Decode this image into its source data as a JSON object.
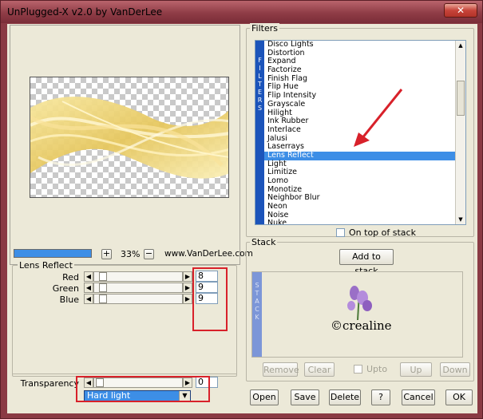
{
  "window": {
    "title": "UnPlugged-X v2.0 by VanDerLee",
    "close_glyph": "✕"
  },
  "preview": {
    "zoom_out_label": "+",
    "zoom_value": "33%",
    "zoom_in_label": "−",
    "website": "www.VanDerLee.com"
  },
  "lens_reflect": {
    "group_label": "Lens Reflect",
    "sliders": [
      {
        "label": "Red",
        "value": "8"
      },
      {
        "label": "Green",
        "value": "9"
      },
      {
        "label": "Blue",
        "value": "9"
      }
    ]
  },
  "transparency": {
    "label": "Transparency",
    "value": "0",
    "blend_mode": "Hard light"
  },
  "filters": {
    "group_label": "Filters",
    "side_letters": [
      "F",
      "I",
      "L",
      "T",
      "E",
      "R",
      "S"
    ],
    "items": [
      "Disco Lights",
      "Distortion",
      "Expand",
      "Factorize",
      "Finish Flag",
      "Flip Hue",
      "Flip Intensity",
      "Grayscale",
      "Hilight",
      "Ink Rubber",
      "Interlace",
      "Jalusi",
      "Laserrays",
      "Lens Reflect",
      "Light",
      "Limitize",
      "Lomo",
      "Monotize",
      "Neighbor Blur",
      "Neon",
      "Noise",
      "Nuke"
    ],
    "selected": "Lens Reflect",
    "on_top_label": "On top of stack"
  },
  "stack": {
    "group_label": "Stack",
    "add_label": "Add to stack",
    "side_letters": [
      "S",
      "T",
      "A",
      "C",
      "K"
    ],
    "logo_text": "©crealine",
    "remove_label": "Remove",
    "clear_label": "Clear",
    "upto_label": "Upto",
    "up_label": "Up",
    "down_label": "Down"
  },
  "footer": {
    "open_label": "Open",
    "save_label": "Save",
    "delete_label": "Delete",
    "help_label": "?",
    "cancel_label": "Cancel",
    "ok_label": "OK"
  },
  "colors": {
    "selection": "#3d8ee6",
    "title_bar": "#8f3c46",
    "annotation_red": "#d8212a"
  }
}
